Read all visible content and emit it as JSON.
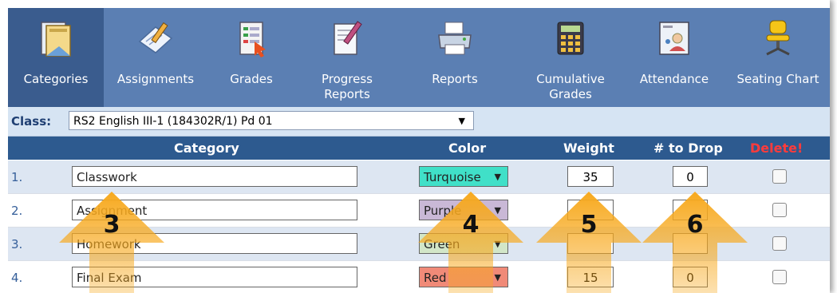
{
  "toolbar": {
    "items": [
      {
        "label": "Categories",
        "icon": "folder-icon"
      },
      {
        "label": "Assignments",
        "icon": "pencil-paper-icon"
      },
      {
        "label": "Grades",
        "icon": "gradebook-icon"
      },
      {
        "label": "Progress Reports",
        "icon": "report-edit-icon"
      },
      {
        "label": "Reports",
        "icon": "printer-icon"
      },
      {
        "label": "Cumulative Grades",
        "icon": "calculator-icon"
      },
      {
        "label": "Attendance",
        "icon": "attendance-icon"
      },
      {
        "label": "Seating Chart",
        "icon": "chair-icon"
      }
    ],
    "active": "Categories"
  },
  "class_row": {
    "label": "Class:",
    "selected": "RS2 English III-1 (184302R/1) Pd 01"
  },
  "table": {
    "headers": {
      "category": "Category",
      "color": "Color",
      "weight": "Weight",
      "drop": "# to Drop",
      "delete": "Delete!"
    },
    "rows": [
      {
        "num": "1.",
        "name": "Classwork",
        "color": "Turquoise",
        "color_hex": "#40e0c8",
        "weight": "35",
        "drop": "0"
      },
      {
        "num": "2.",
        "name": "Assignment",
        "color": "Purple",
        "color_hex": "#c9b8d6",
        "weight": "",
        "drop": ""
      },
      {
        "num": "3.",
        "name": "Homework",
        "color": "Green",
        "color_hex": "#d2e6c8",
        "weight": "",
        "drop": ""
      },
      {
        "num": "4.",
        "name": "Final Exam",
        "color": "Red",
        "color_hex": "#f08a78",
        "weight": "15",
        "drop": "0"
      }
    ]
  },
  "callouts": [
    "3",
    "4",
    "5",
    "6"
  ],
  "colors": {
    "toolbar": "#5b7fb3",
    "active_tab": "#3a5c8e",
    "header": "#2d5a8f",
    "delete_header": "#ff3b3b",
    "arrow": "#f5a623"
  }
}
